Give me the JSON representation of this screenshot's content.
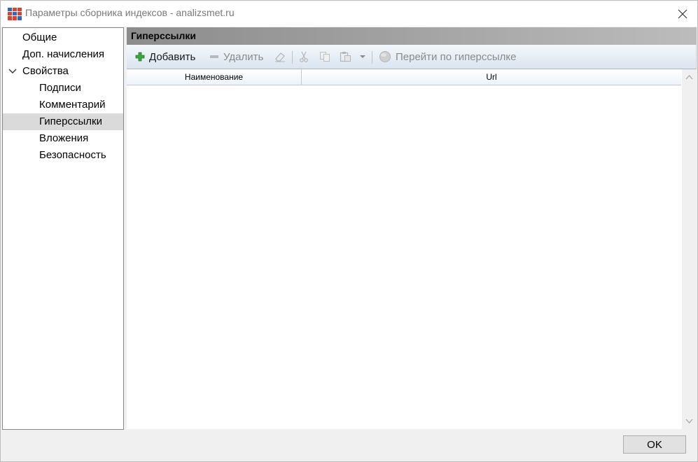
{
  "window": {
    "title": "Параметры сборника индексов - analizsmet.ru",
    "app_icon": "grid-blocks-icon",
    "close_icon": "close-icon"
  },
  "nav": {
    "items": [
      {
        "label": "Общие",
        "level": 0
      },
      {
        "label": "Доп. начисления",
        "level": 0
      },
      {
        "label": "Свойства",
        "level": 0,
        "expanded": true
      },
      {
        "label": "Подписи",
        "level": 1
      },
      {
        "label": "Комментарий",
        "level": 1
      },
      {
        "label": "Гиперссылки",
        "level": 1,
        "selected": true
      },
      {
        "label": "Вложения",
        "level": 1
      },
      {
        "label": "Безопасность",
        "level": 1
      }
    ]
  },
  "section": {
    "title": "Гиперссылки"
  },
  "toolbar": {
    "add_label": "Добавить",
    "delete_label": "Удалить",
    "goto_label": "Перейти по гиперссылке",
    "icons": [
      "plus-icon",
      "minus-icon",
      "eraser-icon",
      "cut-icon",
      "copy-icon",
      "paste-icon",
      "dropdown-arrow-icon",
      "globe-icon"
    ]
  },
  "grid": {
    "columns": [
      "Наименование",
      "Url"
    ],
    "rows": []
  },
  "footer": {
    "ok_label": "OK"
  },
  "colors": {
    "add_icon": "#3aa63a",
    "disabled_text": "#8a8a8a",
    "selected_nav": "#dadada",
    "header_gradient_start": "#8c8c8c"
  }
}
